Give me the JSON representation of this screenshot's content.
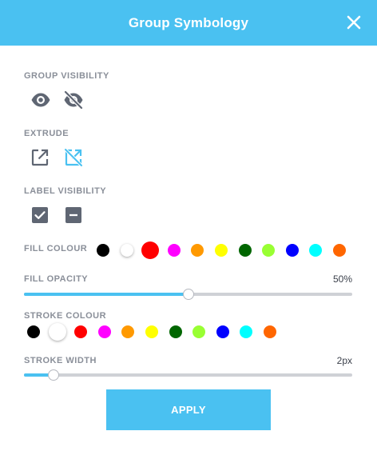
{
  "dialog": {
    "title": "Group Symbology",
    "close_icon": "close-icon"
  },
  "group_visibility": {
    "label": "GROUP VISIBILITY",
    "icons": [
      "eye-icon",
      "eye-off-icon"
    ]
  },
  "extrude": {
    "label": "EXTRUDE",
    "icons": [
      "external-link-icon",
      "external-link-off-icon"
    ]
  },
  "label_visibility": {
    "label": "LABEL VISIBILITY",
    "icons": [
      "checkbox-checked-icon",
      "checkbox-indeterminate-icon"
    ]
  },
  "fill_colour": {
    "label": "FILL COLOUR",
    "selected": "#ff0000",
    "colors": [
      "#000000",
      "#ffffff",
      "#ff0000",
      "#ff00ff",
      "#ff9900",
      "#ffff00",
      "#006600",
      "#99ff33",
      "#0000ff",
      "#00ffff",
      "#ff6600"
    ]
  },
  "fill_opacity": {
    "label": "FILL OPACITY",
    "value_text": "50%",
    "value_fraction": 0.5
  },
  "stroke_colour": {
    "label": "STROKE COLOUR",
    "selected": "#ffffff",
    "colors": [
      "#000000",
      "#ffffff",
      "#ff0000",
      "#ff00ff",
      "#ff9900",
      "#ffff00",
      "#006600",
      "#99ff33",
      "#0000ff",
      "#00ffff",
      "#ff6600"
    ]
  },
  "stroke_width": {
    "label": "STROKE WIDTH",
    "value_text": "2px",
    "value_fraction": 0.09
  },
  "apply": {
    "label": "APPLY"
  },
  "theme": {
    "accent": "#4ac1f1",
    "icon_gray": "#5f6673"
  }
}
